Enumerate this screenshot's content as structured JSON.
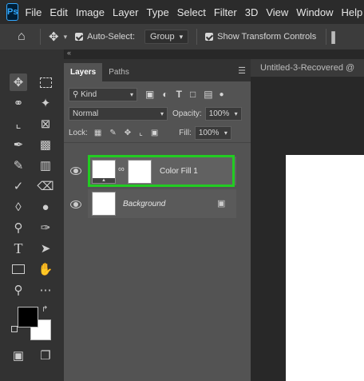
{
  "menubar": {
    "items": [
      "File",
      "Edit",
      "Image",
      "Layer",
      "Type",
      "Select",
      "Filter",
      "3D",
      "View",
      "Window",
      "Help"
    ],
    "logo": "Ps"
  },
  "options": {
    "auto_select_label": "Auto-Select:",
    "auto_select_value": "Group",
    "show_transform_label": "Show Transform Controls"
  },
  "panel": {
    "tabs": [
      "Layers",
      "Paths"
    ],
    "filter_kind": "Kind",
    "blend_mode": "Normal",
    "opacity_label": "Opacity:",
    "opacity_value": "100%",
    "lock_label": "Lock:",
    "fill_label": "Fill:",
    "fill_value": "100%",
    "layers": [
      {
        "name": "Color Fill 1",
        "selected": true
      },
      {
        "name": "Background",
        "locked": true
      }
    ]
  },
  "document": {
    "tab_title": "Untitled-3-Recovered @"
  },
  "colors": {
    "highlight": "#22cc22"
  }
}
